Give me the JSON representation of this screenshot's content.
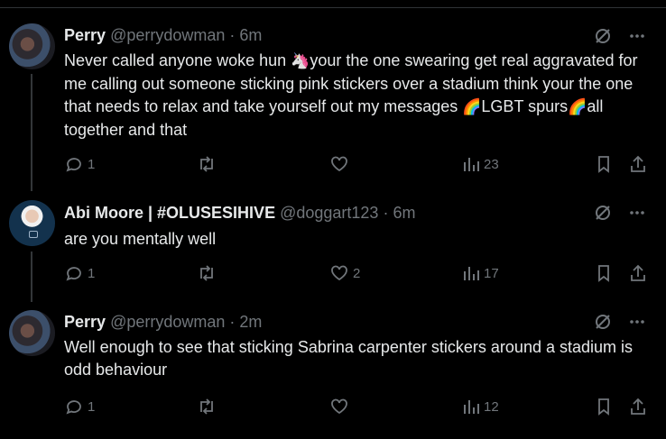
{
  "tweets": [
    {
      "name": "Perry",
      "handle": "@perrydowman",
      "dot": "·",
      "time": "6m",
      "text_parts": [
        "Never called anyone woke hun ",
        "🦄",
        "your the one swearing get real aggravated for me calling out someone sticking pink stickers over a stadium think your the one that needs to relax and take yourself out my messages ",
        "🌈",
        "LGBT spurs",
        "🌈",
        "all together and that"
      ],
      "replies": "1",
      "reposts": "",
      "likes": "",
      "views": "23"
    },
    {
      "name": "Abi Moore | #OLUSESIHIVE",
      "handle": "@doggart123",
      "dot": "·",
      "time": "6m",
      "text": "are you mentally well",
      "replies": "1",
      "reposts": "",
      "likes": "2",
      "views": "17"
    },
    {
      "name": "Perry",
      "handle": "@perrydowman",
      "dot": "·",
      "time": "2m",
      "text": "Well enough to see that sticking Sabrina carpenter stickers around a stadium is odd behaviour",
      "replies": "1",
      "reposts": "",
      "likes": "",
      "views": "12"
    }
  ],
  "icons": [
    "grok-icon",
    "more-icon",
    "reply-icon",
    "repost-icon",
    "like-icon",
    "views-icon",
    "bookmark-icon",
    "share-icon"
  ],
  "colors": {
    "background": "#000000",
    "text": "#e7e9ea",
    "secondary": "#71767b",
    "divider": "#2f3336"
  }
}
